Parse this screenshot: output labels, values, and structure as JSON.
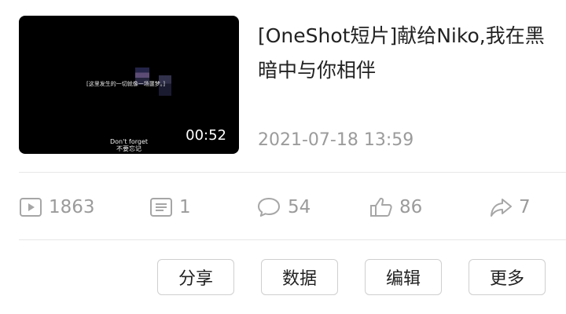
{
  "video": {
    "thumbnail_subtitle": "[这里发生的一切就像一场噩梦。]",
    "thumbnail_caption_en": "Don't forget",
    "thumbnail_caption_zh": "不要忘记",
    "duration": "00:52"
  },
  "title": "[OneShot短片]献给Niko,我在黑暗中与你相伴",
  "date": "2021-07-18 13:59",
  "stats": {
    "views": "1863",
    "danmaku": "1",
    "comments": "54",
    "likes": "86",
    "shares": "7"
  },
  "actions": {
    "share": "分享",
    "data": "数据",
    "edit": "编辑",
    "more": "更多"
  },
  "colors": {
    "text_primary": "#222222",
    "text_secondary": "#9b9b9b",
    "divider": "#e7e7e7",
    "button_border": "#cfcfcf"
  }
}
